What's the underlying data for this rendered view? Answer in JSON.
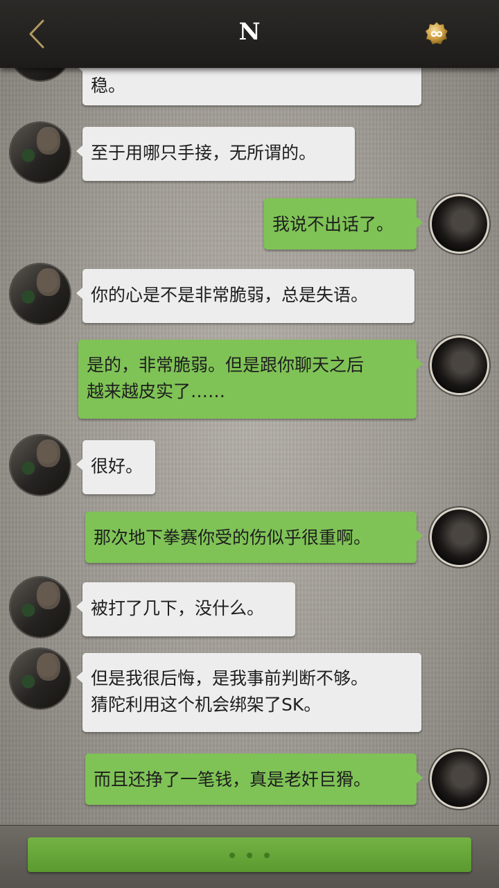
{
  "header": {
    "title": "N",
    "back_icon": "chevron-left-icon",
    "badge_icon": "infinity-badge-icon",
    "accent": "#c9b07a"
  },
  "messages": [
    {
      "from": "other",
      "lines": [
        "稳。"
      ]
    },
    {
      "from": "other",
      "lines": [
        "至于用哪只手接，无所谓的。"
      ]
    },
    {
      "from": "me",
      "lines": [
        "我说不出话了。"
      ]
    },
    {
      "from": "other",
      "lines": [
        "你的心是不是非常脆弱，总是失语。"
      ]
    },
    {
      "from": "me",
      "lines": [
        "是的，非常脆弱。但是跟你聊天之后",
        "越来越皮实了……"
      ]
    },
    {
      "from": "other",
      "lines": [
        "很好。"
      ]
    },
    {
      "from": "me",
      "lines": [
        "那次地下拳赛你受的伤似乎很重啊。"
      ]
    },
    {
      "from": "other",
      "lines": [
        "被打了几下，没什么。"
      ]
    },
    {
      "from": "other",
      "lines": [
        "但是我很后悔，是我事前判断不够。",
        "猜陀利用这个机会绑架了SK。"
      ]
    },
    {
      "from": "me",
      "lines": [
        "而且还挣了一笔钱，真是老奸巨猾。"
      ]
    }
  ],
  "bottom": {
    "button_icon": "more-dots-icon",
    "button_color": "#6aa83a"
  }
}
